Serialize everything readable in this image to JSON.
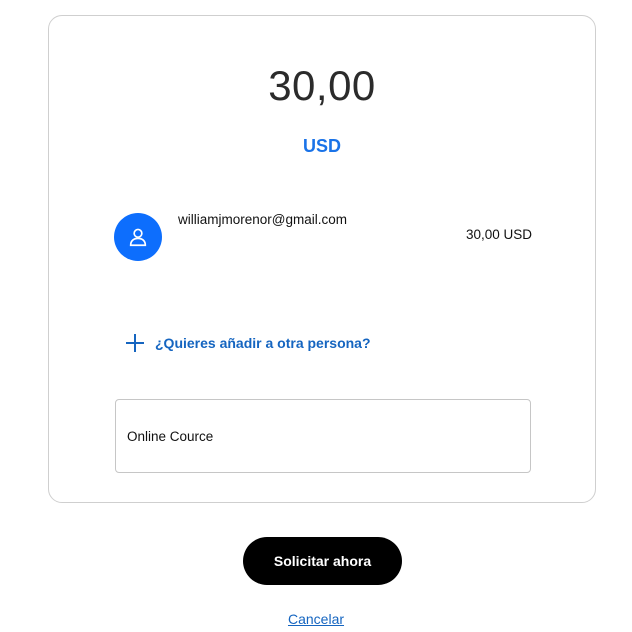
{
  "request": {
    "amount": "30,00",
    "currency": "USD"
  },
  "recipient": {
    "avatar_icon": "user-icon",
    "email": "williamjmorenor@gmail.com",
    "amount": "30,00 USD"
  },
  "add_person": {
    "icon": "plus-icon",
    "label": "¿Quieres añadir a otra persona?"
  },
  "note": {
    "value": "Online Cource"
  },
  "actions": {
    "submit_label": "Solicitar ahora",
    "cancel_label": "Cancelar"
  },
  "colors": {
    "accent": "#1a73e8",
    "link": "#1565c0",
    "avatar_bg": "#0d6efd",
    "primary_button_bg": "#000000"
  }
}
